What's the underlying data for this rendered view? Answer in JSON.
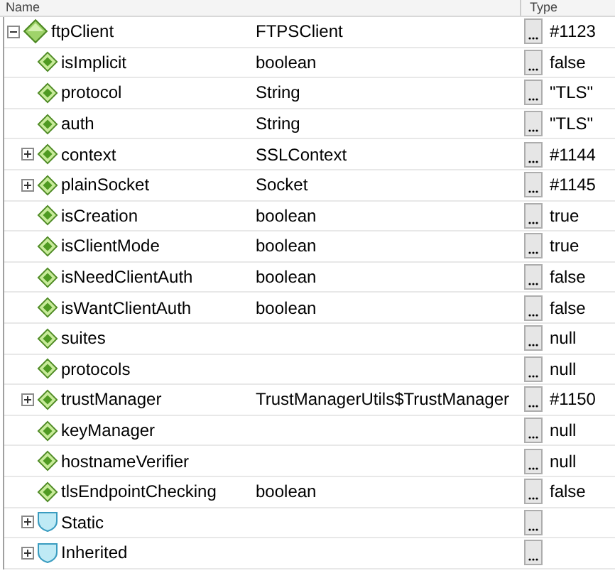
{
  "header": {
    "name": "Name",
    "type": "Type"
  },
  "tree": [
    {
      "name": "ftpClient",
      "kind": "object",
      "type": "FTPSClient",
      "value": "#1123",
      "expanded": true,
      "children": [
        {
          "name": "isImplicit",
          "kind": "field",
          "type": "boolean",
          "value": "false"
        },
        {
          "name": "protocol",
          "kind": "field",
          "type": "String",
          "value": "\"TLS\""
        },
        {
          "name": "auth",
          "kind": "field",
          "type": "String",
          "value": "\"TLS\""
        },
        {
          "name": "context",
          "kind": "field",
          "type": "SSLContext",
          "value": "#1144",
          "expanded": false
        },
        {
          "name": "plainSocket",
          "kind": "field",
          "type": "Socket",
          "value": "#1145",
          "expanded": false
        },
        {
          "name": "isCreation",
          "kind": "field",
          "type": "boolean",
          "value": "true"
        },
        {
          "name": "isClientMode",
          "kind": "field",
          "type": "boolean",
          "value": "true"
        },
        {
          "name": "isNeedClientAuth",
          "kind": "field",
          "type": "boolean",
          "value": "false"
        },
        {
          "name": "isWantClientAuth",
          "kind": "field",
          "type": "boolean",
          "value": "false"
        },
        {
          "name": "suites",
          "kind": "field",
          "value": "null"
        },
        {
          "name": "protocols",
          "kind": "field",
          "value": "null"
        },
        {
          "name": "trustManager",
          "kind": "field",
          "type": "TrustManagerUtils$TrustManager",
          "value": "#1150",
          "expanded": false
        },
        {
          "name": "keyManager",
          "kind": "field",
          "value": "null"
        },
        {
          "name": "hostnameVerifier",
          "kind": "field",
          "value": "null"
        },
        {
          "name": "tlsEndpointChecking",
          "kind": "field",
          "type": "boolean",
          "value": "false"
        },
        {
          "name": "Static",
          "kind": "group",
          "expanded": false
        },
        {
          "name": "Inherited",
          "kind": "group",
          "expanded": false
        }
      ]
    }
  ]
}
